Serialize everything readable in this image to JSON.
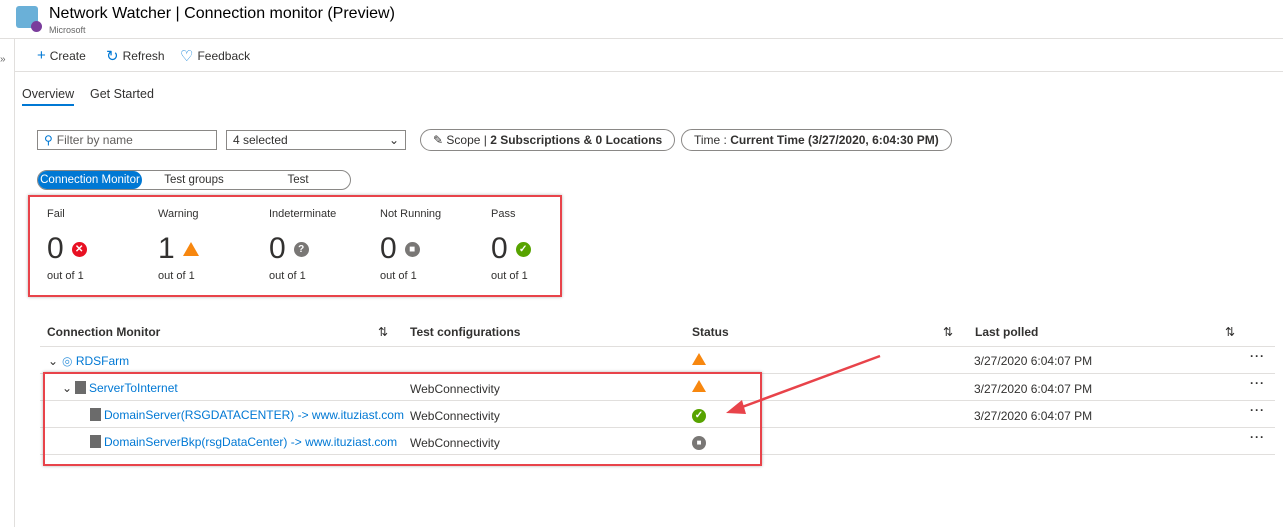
{
  "header": {
    "title": "Network Watcher | Connection monitor (Preview)",
    "subtitle": "Microsoft"
  },
  "toolbar": {
    "create": "Create",
    "refresh": "Refresh",
    "feedback": "Feedback"
  },
  "tabs": [
    {
      "label": "Overview",
      "active": true
    },
    {
      "label": "Get Started"
    }
  ],
  "filters": {
    "search_placeholder": "Filter by name",
    "select_value": "4 selected",
    "scope_label": "Scope | ",
    "scope_value": "2 Subscriptions & 0 Locations",
    "time_label": "Time : ",
    "time_value": "Current Time (3/27/2020, 6:04:30 PM)"
  },
  "views": [
    "Connection Monitor",
    "Test groups",
    "Test"
  ],
  "stats": [
    {
      "label": "Fail",
      "count": "0",
      "of": "out of 1",
      "color": "#e81123"
    },
    {
      "label": "Warning",
      "count": "1",
      "of": "out of 1",
      "color": "#f7870f"
    },
    {
      "label": "Indeterminate",
      "count": "0",
      "of": "out of 1",
      "color": "#797775"
    },
    {
      "label": "Not Running",
      "count": "0",
      "of": "out of 1",
      "color": "#797775"
    },
    {
      "label": "Pass",
      "count": "0",
      "of": "out of 1",
      "color": "#57a300"
    }
  ],
  "table": {
    "headers": [
      "Connection Monitor",
      "Test configurations",
      "Status",
      "Last polled"
    ],
    "rows": [
      {
        "name": "RDSFarm",
        "config": "",
        "status": "warning",
        "polled": "3/27/2020 6:04:07 PM"
      },
      {
        "name": "ServerToInternet",
        "config": "WebConnectivity",
        "status": "warning",
        "polled": "3/27/2020 6:04:07 PM"
      },
      {
        "name": "DomainServer(RSGDATACENTER) -> www.ituziast.com",
        "config": "WebConnectivity",
        "status": "pass",
        "polled": "3/27/2020 6:04:07 PM"
      },
      {
        "name": "DomainServerBkp(rsgDataCenter) -> www.ituziast.com",
        "config": "WebConnectivity",
        "status": "notrunning",
        "polled": ""
      }
    ]
  }
}
